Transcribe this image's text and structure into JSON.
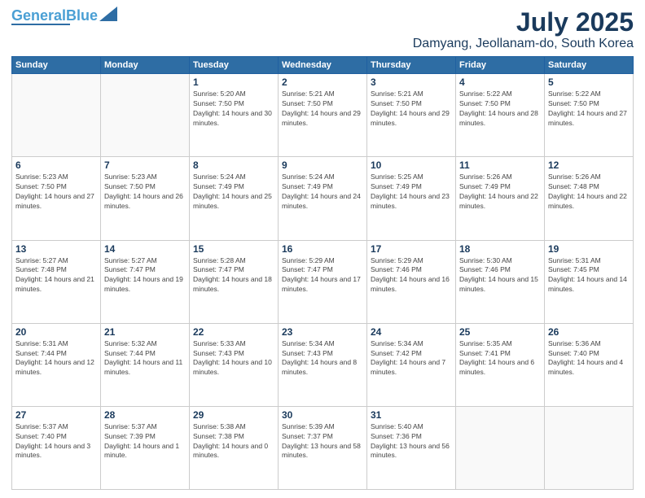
{
  "header": {
    "logo_general": "General",
    "logo_blue": "Blue",
    "month_year": "July 2025",
    "location": "Damyang, Jeollanam-do, South Korea"
  },
  "days_of_week": [
    "Sunday",
    "Monday",
    "Tuesday",
    "Wednesday",
    "Thursday",
    "Friday",
    "Saturday"
  ],
  "weeks": [
    [
      {
        "day": "",
        "content": ""
      },
      {
        "day": "",
        "content": ""
      },
      {
        "day": "1",
        "content": "Sunrise: 5:20 AM\nSunset: 7:50 PM\nDaylight: 14 hours and 30 minutes."
      },
      {
        "day": "2",
        "content": "Sunrise: 5:21 AM\nSunset: 7:50 PM\nDaylight: 14 hours and 29 minutes."
      },
      {
        "day": "3",
        "content": "Sunrise: 5:21 AM\nSunset: 7:50 PM\nDaylight: 14 hours and 29 minutes."
      },
      {
        "day": "4",
        "content": "Sunrise: 5:22 AM\nSunset: 7:50 PM\nDaylight: 14 hours and 28 minutes."
      },
      {
        "day": "5",
        "content": "Sunrise: 5:22 AM\nSunset: 7:50 PM\nDaylight: 14 hours and 27 minutes."
      }
    ],
    [
      {
        "day": "6",
        "content": "Sunrise: 5:23 AM\nSunset: 7:50 PM\nDaylight: 14 hours and 27 minutes."
      },
      {
        "day": "7",
        "content": "Sunrise: 5:23 AM\nSunset: 7:50 PM\nDaylight: 14 hours and 26 minutes."
      },
      {
        "day": "8",
        "content": "Sunrise: 5:24 AM\nSunset: 7:49 PM\nDaylight: 14 hours and 25 minutes."
      },
      {
        "day": "9",
        "content": "Sunrise: 5:24 AM\nSunset: 7:49 PM\nDaylight: 14 hours and 24 minutes."
      },
      {
        "day": "10",
        "content": "Sunrise: 5:25 AM\nSunset: 7:49 PM\nDaylight: 14 hours and 23 minutes."
      },
      {
        "day": "11",
        "content": "Sunrise: 5:26 AM\nSunset: 7:49 PM\nDaylight: 14 hours and 22 minutes."
      },
      {
        "day": "12",
        "content": "Sunrise: 5:26 AM\nSunset: 7:48 PM\nDaylight: 14 hours and 22 minutes."
      }
    ],
    [
      {
        "day": "13",
        "content": "Sunrise: 5:27 AM\nSunset: 7:48 PM\nDaylight: 14 hours and 21 minutes."
      },
      {
        "day": "14",
        "content": "Sunrise: 5:27 AM\nSunset: 7:47 PM\nDaylight: 14 hours and 19 minutes."
      },
      {
        "day": "15",
        "content": "Sunrise: 5:28 AM\nSunset: 7:47 PM\nDaylight: 14 hours and 18 minutes."
      },
      {
        "day": "16",
        "content": "Sunrise: 5:29 AM\nSunset: 7:47 PM\nDaylight: 14 hours and 17 minutes."
      },
      {
        "day": "17",
        "content": "Sunrise: 5:29 AM\nSunset: 7:46 PM\nDaylight: 14 hours and 16 minutes."
      },
      {
        "day": "18",
        "content": "Sunrise: 5:30 AM\nSunset: 7:46 PM\nDaylight: 14 hours and 15 minutes."
      },
      {
        "day": "19",
        "content": "Sunrise: 5:31 AM\nSunset: 7:45 PM\nDaylight: 14 hours and 14 minutes."
      }
    ],
    [
      {
        "day": "20",
        "content": "Sunrise: 5:31 AM\nSunset: 7:44 PM\nDaylight: 14 hours and 12 minutes."
      },
      {
        "day": "21",
        "content": "Sunrise: 5:32 AM\nSunset: 7:44 PM\nDaylight: 14 hours and 11 minutes."
      },
      {
        "day": "22",
        "content": "Sunrise: 5:33 AM\nSunset: 7:43 PM\nDaylight: 14 hours and 10 minutes."
      },
      {
        "day": "23",
        "content": "Sunrise: 5:34 AM\nSunset: 7:43 PM\nDaylight: 14 hours and 8 minutes."
      },
      {
        "day": "24",
        "content": "Sunrise: 5:34 AM\nSunset: 7:42 PM\nDaylight: 14 hours and 7 minutes."
      },
      {
        "day": "25",
        "content": "Sunrise: 5:35 AM\nSunset: 7:41 PM\nDaylight: 14 hours and 6 minutes."
      },
      {
        "day": "26",
        "content": "Sunrise: 5:36 AM\nSunset: 7:40 PM\nDaylight: 14 hours and 4 minutes."
      }
    ],
    [
      {
        "day": "27",
        "content": "Sunrise: 5:37 AM\nSunset: 7:40 PM\nDaylight: 14 hours and 3 minutes."
      },
      {
        "day": "28",
        "content": "Sunrise: 5:37 AM\nSunset: 7:39 PM\nDaylight: 14 hours and 1 minute."
      },
      {
        "day": "29",
        "content": "Sunrise: 5:38 AM\nSunset: 7:38 PM\nDaylight: 14 hours and 0 minutes."
      },
      {
        "day": "30",
        "content": "Sunrise: 5:39 AM\nSunset: 7:37 PM\nDaylight: 13 hours and 58 minutes."
      },
      {
        "day": "31",
        "content": "Sunrise: 5:40 AM\nSunset: 7:36 PM\nDaylight: 13 hours and 56 minutes."
      },
      {
        "day": "",
        "content": ""
      },
      {
        "day": "",
        "content": ""
      }
    ]
  ]
}
